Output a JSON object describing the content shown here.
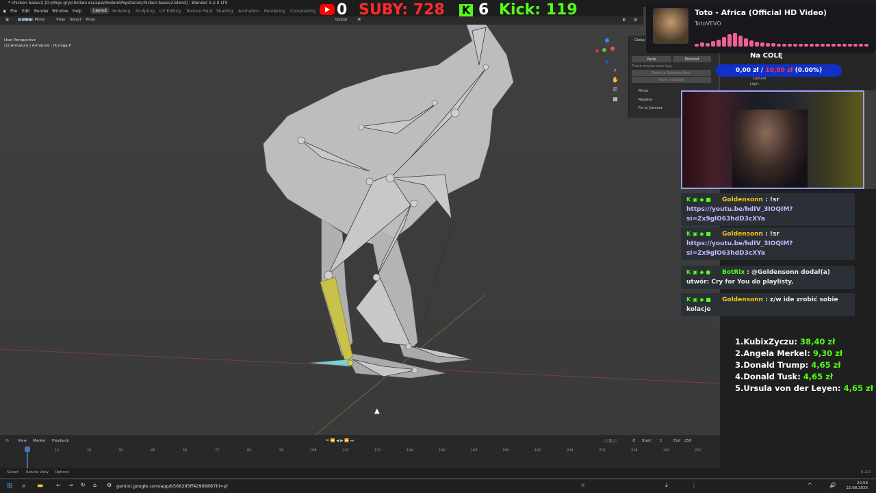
{
  "window": {
    "title": "* chicken basev2 [D:\\Moje gry\\chicken escape\\Modele\\Popstacie\\chicken basev2.blend] - Blender 5.2.0 LTS"
  },
  "menu": {
    "items": [
      "File",
      "Edit",
      "Render",
      "Window",
      "Help"
    ]
  },
  "workspaces": {
    "tabs": [
      "Layout",
      "Modeling",
      "Sculpting",
      "UV Editing",
      "Texture Paint",
      "Shading",
      "Animation",
      "Rendering",
      "Compositing"
    ],
    "active": "Layout"
  },
  "viewport_header": {
    "mode": "Pose Mode",
    "items": [
      "View",
      "Select",
      "Pose"
    ],
    "orientation": "Global"
  },
  "viewport": {
    "info_line1": "User Perspective",
    "info_line2": "(1) Armature | Armature : IK.noga.P"
  },
  "npanel": {
    "section": "Global",
    "paste_label": "Paste",
    "mirrored_label": "Mirrored",
    "hint": "These require auto-key:",
    "paste_selected": "Paste to Selected Keys",
    "paste_bake": "Paste and Bake",
    "options": [
      "Mirror",
      "Relative",
      "Fix to Camera"
    ]
  },
  "timeline": {
    "menus": [
      "View",
      "Marker",
      "Playback"
    ],
    "current_frame": "1",
    "start_label": "Start",
    "start_value": "1",
    "end_label": "End",
    "end_value": "250",
    "ticks": [
      "1",
      "12",
      "24",
      "36",
      "48",
      "60",
      "72",
      "84",
      "96",
      "108",
      "120",
      "132",
      "144",
      "156",
      "168",
      "180",
      "192",
      "204",
      "216",
      "228",
      "240",
      "252"
    ]
  },
  "statusbar": {
    "items": [
      "Select",
      "Rotate View",
      "Options"
    ],
    "version": "5.2.0"
  },
  "taskbar": {
    "url": "gemini.google.com/app/b566295ff42966887hl=pl",
    "time": "20:58",
    "date": "22.08.2026"
  },
  "stream": {
    "yt_count": "0",
    "suby_label": "SUBY: 728",
    "kick_count": "6",
    "kick_label": "Kick: 119",
    "colors": {
      "youtube": "#ff0000",
      "kick": "#53fc18",
      "suby": "#ff2a2a"
    }
  },
  "music": {
    "title": "Toto - Africa (Official HD Video)",
    "artist": "TotoVEVO"
  },
  "goal": {
    "title": "Na COLĘ",
    "current": "0,00 zł",
    "separator": " / ",
    "target": "10,00 zł",
    "percent": "(0.00%)"
  },
  "outliner": {
    "items": [
      "Camera",
      "Light"
    ]
  },
  "chat": {
    "messages": [
      {
        "user": "Goldensonn",
        "text": " : !sr ",
        "link": "https://youtu.be/hdIV_3IOQIM?si=Zx9glO63hdD3cXYa"
      },
      {
        "user": "Goldensonn",
        "text": " : !sr ",
        "link": "https://youtu.be/hdIV_3IOQIM?si=Zx9glO63hdD3cXYa"
      },
      {
        "user": "BotRix",
        "text": " : @Goldensonn dodał(a) utwór: Cry for You do playlisty.",
        "link": ""
      },
      {
        "user": "Goldensonn",
        "text": " : z/w ide zrobić sobie kolacje",
        "link": ""
      }
    ]
  },
  "donors": [
    {
      "rank": "1.",
      "name": "KubixZyczu: ",
      "amount": "38,40 zł"
    },
    {
      "rank": "2.",
      "name": "Angela Merkel: ",
      "amount": "9,30 zł"
    },
    {
      "rank": "3.",
      "name": "Donald Trump: ",
      "amount": "4,65 zł"
    },
    {
      "rank": "4.",
      "name": "Donald Tusk: ",
      "amount": "4,65 zł"
    },
    {
      "rank": "5.",
      "name": "Ursula von der Leyen: ",
      "amount": "4,65 zł"
    }
  ]
}
